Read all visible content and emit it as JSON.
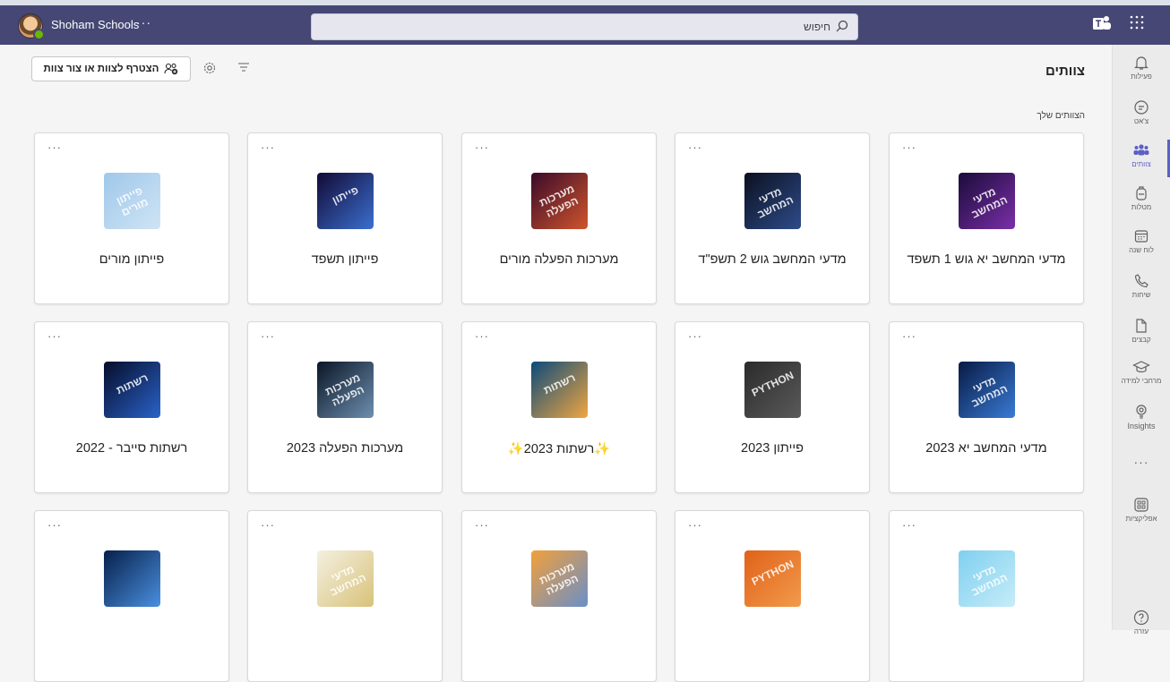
{
  "topbar": {
    "org_name": "Shoham Schools",
    "more": "···",
    "search_placeholder": "חיפוש"
  },
  "header": {
    "title": "צוותים",
    "join_button": "הצטרף לצוות או צור צוות",
    "section_label": "הצוותים שלך"
  },
  "rail": {
    "items": [
      {
        "label": "פעילות",
        "icon": "bell-icon"
      },
      {
        "label": "צ'אט",
        "icon": "chat-icon"
      },
      {
        "label": "צוותים",
        "icon": "teams-icon",
        "active": true
      },
      {
        "label": "מטלות",
        "icon": "backpack-icon"
      },
      {
        "label": "לוח שנה",
        "icon": "calendar-icon"
      },
      {
        "label": "שיחות",
        "icon": "phone-icon"
      },
      {
        "label": "קבצים",
        "icon": "file-icon"
      },
      {
        "label": "מרחבי למידה",
        "icon": "graduation-cap-icon"
      },
      {
        "label": "Insights",
        "icon": "lightbulb-icon"
      }
    ],
    "more": "···",
    "apps_label": "אפליקציות",
    "help_label": "עזרה"
  },
  "teams": [
    {
      "name": "מדעי המחשב יא גוש 1 תשפד",
      "thumb_text": "מדעי המחשב",
      "colors": [
        "#1b0b3a",
        "#7a2fa8"
      ]
    },
    {
      "name": "מדעי המחשב גוש 2 תשפ\"ד",
      "thumb_text": "מדעי המחשב",
      "colors": [
        "#0b1020",
        "#2e4c8a"
      ]
    },
    {
      "name": "מערכות הפעלה מורים",
      "thumb_text": "מערכות הפעלה",
      "colors": [
        "#3a0a2a",
        "#d0542c"
      ]
    },
    {
      "name": "פייתון תשפד",
      "thumb_text": "פייתון",
      "colors": [
        "#120a35",
        "#3b6fd0"
      ]
    },
    {
      "name": "פייתון מורים",
      "thumb_text": "פייתון מורים",
      "colors": [
        "#9fc8ea",
        "#cfe4f5"
      ]
    },
    {
      "name": "מדעי המחשב יא 2023",
      "thumb_text": "מדעי המחשב",
      "colors": [
        "#071a45",
        "#3a7bd5"
      ]
    },
    {
      "name": "פייתון 2023",
      "thumb_text": "PYTHON",
      "colors": [
        "#2b2b2b",
        "#5a5a5a"
      ]
    },
    {
      "name": "✨רשתות 2023✨",
      "thumb_text": "רשתות",
      "colors": [
        "#0c4a7a",
        "#f0a640"
      ]
    },
    {
      "name": "מערכות הפעלה 2023",
      "thumb_text": "מערכות הפעלה",
      "colors": [
        "#0a1626",
        "#6d8fb0"
      ]
    },
    {
      "name": "רשתות סייבר - 2022",
      "thumb_text": "רשתות",
      "colors": [
        "#050d2a",
        "#2a62c9"
      ]
    },
    {
      "name": "",
      "thumb_text": "מדעי המחשב",
      "colors": [
        "#7fd0f0",
        "#c6ecf8"
      ]
    },
    {
      "name": "",
      "thumb_text": "PYTHON",
      "colors": [
        "#e0621a",
        "#f29a4a"
      ]
    },
    {
      "name": "",
      "thumb_text": "מערכות הפעלה",
      "colors": [
        "#f2a03a",
        "#6a8fc9"
      ]
    },
    {
      "name": "",
      "thumb_text": "מדעי המחשב",
      "colors": [
        "#f4f0e0",
        "#d8c27a"
      ]
    },
    {
      "name": "",
      "thumb_text": "",
      "colors": [
        "#06204a",
        "#4a8fe0"
      ]
    }
  ]
}
